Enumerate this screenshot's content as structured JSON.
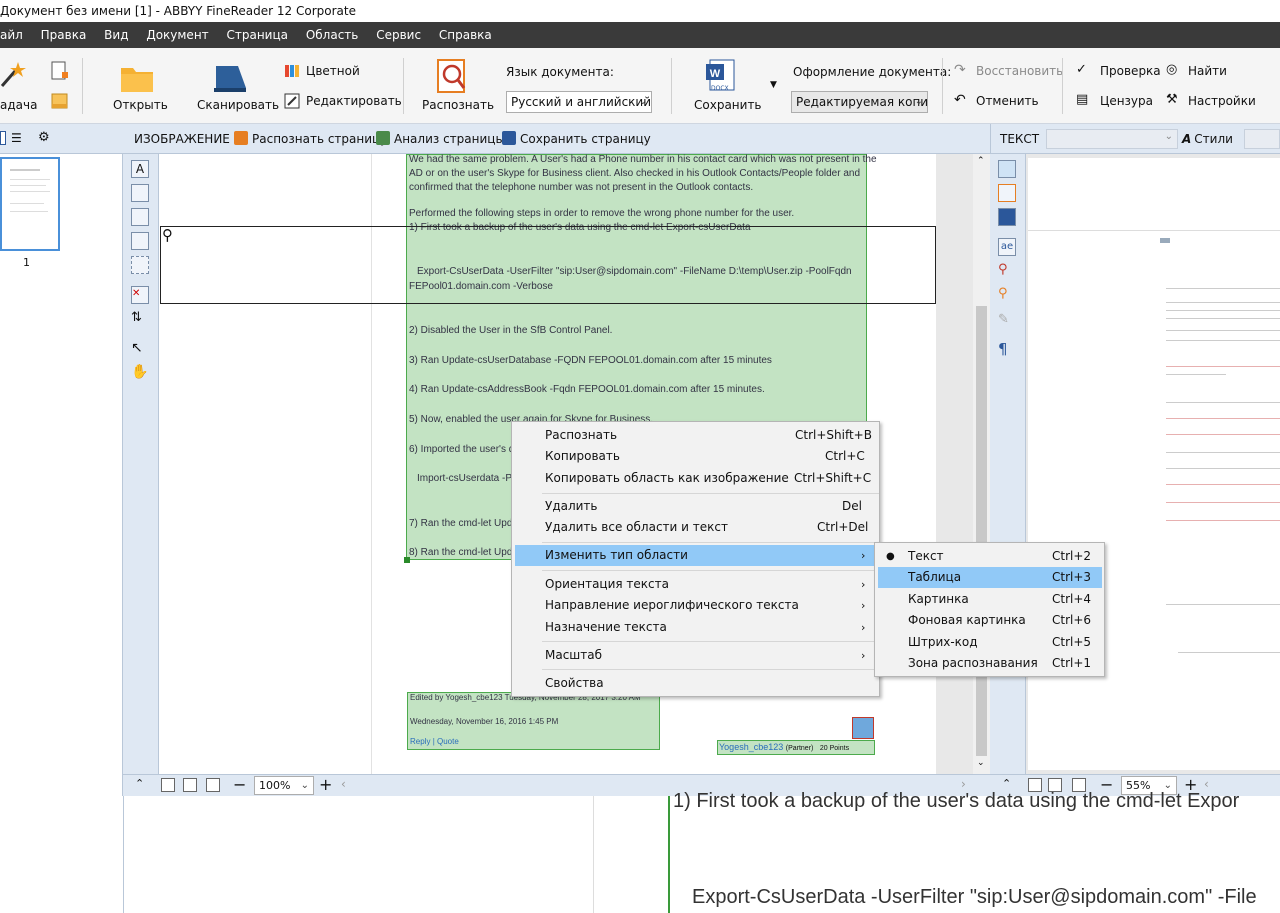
{
  "title": "Документ без имени [1] - ABBYY FineReader 12 Corporate",
  "menu": [
    "айл",
    "Правка",
    "Вид",
    "Документ",
    "Страница",
    "Область",
    "Сервис",
    "Справка"
  ],
  "ribbon": {
    "task_label": "адача",
    "open_label": "Открыть",
    "scan_label": "Сканировать",
    "color_label": "Цветной",
    "edit_label": "Редактировать",
    "recognize_label": "Распознать",
    "doc_lang_label": "Язык документа:",
    "doc_lang_value": "Русский и английский",
    "save_label": "Сохранить",
    "docx_badge": "DOCX",
    "format_label": "Оформление документа:",
    "format_value": "Редактируемая копия",
    "restore_label": "Восстановить",
    "undo_label": "Отменить",
    "check_label": "Проверка",
    "censor_label": "Цензура",
    "find_label": "Найти",
    "settings_label": "Настройки"
  },
  "panelbar": {
    "image_label": "ИЗОБРАЖЕНИЕ",
    "recognize_page": "Распознать страницу",
    "analyze_page": "Анализ страницы",
    "save_page": "Сохранить страницу",
    "text_label": "ТЕКСТ",
    "styles_label": "Стили"
  },
  "thumbnail": {
    "page_number": "1"
  },
  "document": {
    "lines": [
      "We had the same problem. A User's had a Phone number in his contact card which was not present in the",
      "AD or on the user's Skype for Business client. Also checked in his Outlook Contacts/People folder  and",
      "confirmed that the telephone number was not present in the Outlook contacts.",
      "Performed the following steps in order to remove the wrong phone number for the user.",
      "1) First took a backup of the user's data using the cmd-let Export-csUserData",
      "Export-CsUserData -UserFilter \"sip:User@sipdomain.com\" -FileName D:\\temp\\User.zip -PoolFqdn",
      "FEPool01.domain.com -Verbose",
      "2) Disabled the User in the SfB Control Panel.",
      "3) Ran Update-csUserDatabase -FQDN FEPOOL01.domain.com after 15 minutes",
      "4) Ran Update-csAddressBook -Fqdn FEPOOL01.domain.com after 15 minutes.",
      "5) Now, enabled the user again for Skype for Business.",
      "6) Imported the user's d",
      "Import-csUserdata -Po",
      "7) Ran the cmd-let Upd",
      "8) Ran  the cmd-let Upd"
    ],
    "edited_by": "Edited by  Yogesh_cbe123    Tuesday, November 28, 2017 3:20 AM",
    "date": "Wednesday, November 16, 2016 1:45 PM",
    "reply": "Reply",
    "sep": "|",
    "quote": "Quote",
    "author": "Yogesh_cbe123",
    "partner": "(Partner)",
    "points": "20 Points"
  },
  "context_menu": {
    "items": [
      {
        "label": "Распознать",
        "shortcut": "Ctrl+Shift+B"
      },
      {
        "label": "Копировать",
        "shortcut": "Ctrl+C"
      },
      {
        "label": "Копировать область как изображение",
        "shortcut": "Ctrl+Shift+C"
      },
      {
        "label": "Удалить",
        "shortcut": "Del"
      },
      {
        "label": "Удалить все области и текст",
        "shortcut": "Ctrl+Del"
      },
      {
        "label": "Изменить тип области",
        "shortcut": ""
      },
      {
        "label": "Ориентация текста",
        "shortcut": ""
      },
      {
        "label": "Направление иероглифического текста",
        "shortcut": ""
      },
      {
        "label": "Назначение текста",
        "shortcut": ""
      },
      {
        "label": "Масштаб",
        "shortcut": ""
      },
      {
        "label": "Свойства",
        "shortcut": ""
      }
    ]
  },
  "submenu": {
    "items": [
      {
        "label": "Текст",
        "shortcut": "Ctrl+2"
      },
      {
        "label": "Таблица",
        "shortcut": "Ctrl+3"
      },
      {
        "label": "Картинка",
        "shortcut": "Ctrl+4"
      },
      {
        "label": "Фоновая картинка",
        "shortcut": "Ctrl+6"
      },
      {
        "label": "Штрих-код",
        "shortcut": "Ctrl+5"
      },
      {
        "label": "Зона распознавания",
        "shortcut": "Ctrl+1"
      }
    ]
  },
  "zoom": {
    "image_zoom": "100%",
    "text_zoom": "55%"
  },
  "zoom_area": {
    "line1": "1) First took a backup of the user's data using the cmd-let Expor",
    "line2": "Export-CsUserData -UserFilter \"sip:User@sipdomain.com\" -File"
  },
  "colors": {
    "region_green": "#c3e3c3",
    "highlight": "#91c9f7",
    "menubar": "#3a3a3a"
  }
}
